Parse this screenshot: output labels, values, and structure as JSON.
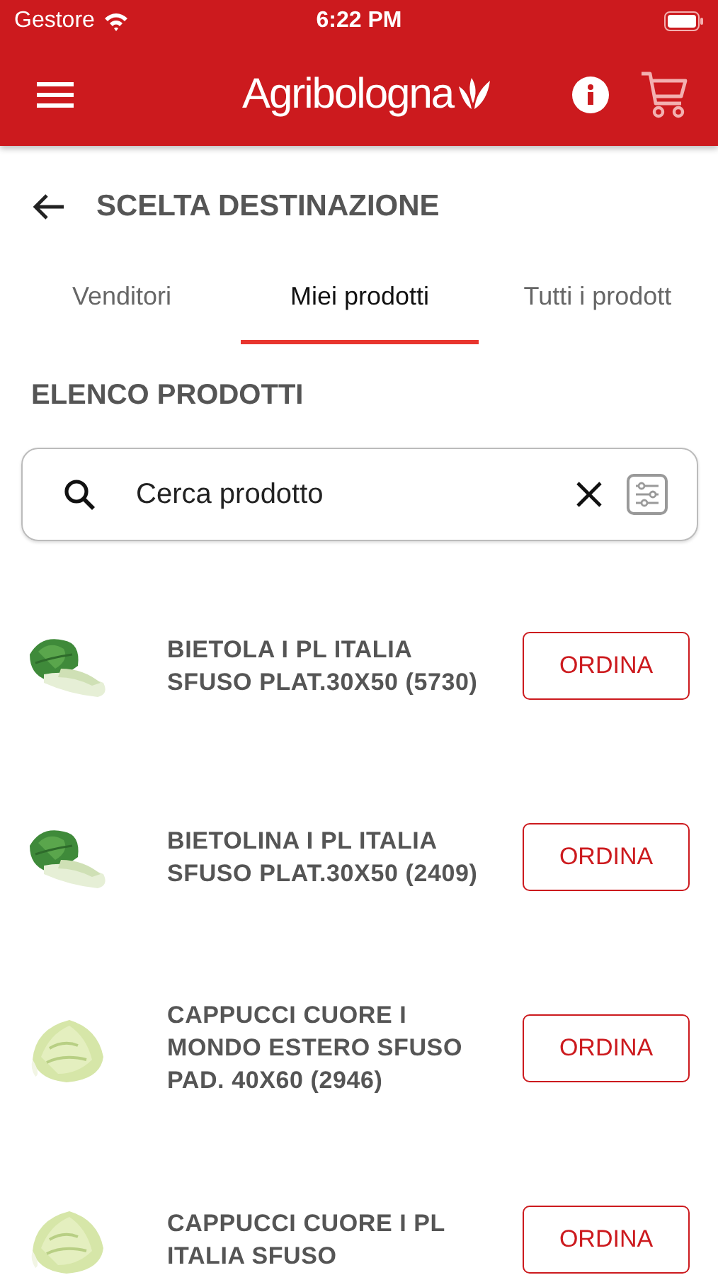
{
  "status_bar": {
    "carrier": "Gestore",
    "time": "6:22 PM"
  },
  "header": {
    "logo": "Agribologna"
  },
  "page": {
    "title": "SCELTA DESTINAZIONE"
  },
  "tabs": [
    {
      "label": "Venditori",
      "selected": false
    },
    {
      "label": "Miei prodotti",
      "selected": true
    },
    {
      "label": "Tutti i prodott",
      "selected": false
    }
  ],
  "section_title": "ELENCO PRODOTTI",
  "search": {
    "placeholder": "Cerca prodotto"
  },
  "products": [
    {
      "name": "BIETOLA I PL ITALIA SFUSO PLAT.30X50 (5730)",
      "button": "ORDINA"
    },
    {
      "name": "BIETOLINA I PL ITALIA SFUSO PLAT.30X50 (2409)",
      "button": "ORDINA"
    },
    {
      "name": "CAPPUCCI CUORE I MONDO ESTERO SFUSO PAD. 40X60 (2946)",
      "button": "ORDINA"
    },
    {
      "name": "CAPPUCCI CUORE I PL ITALIA SFUSO",
      "button": "ORDINA"
    }
  ]
}
